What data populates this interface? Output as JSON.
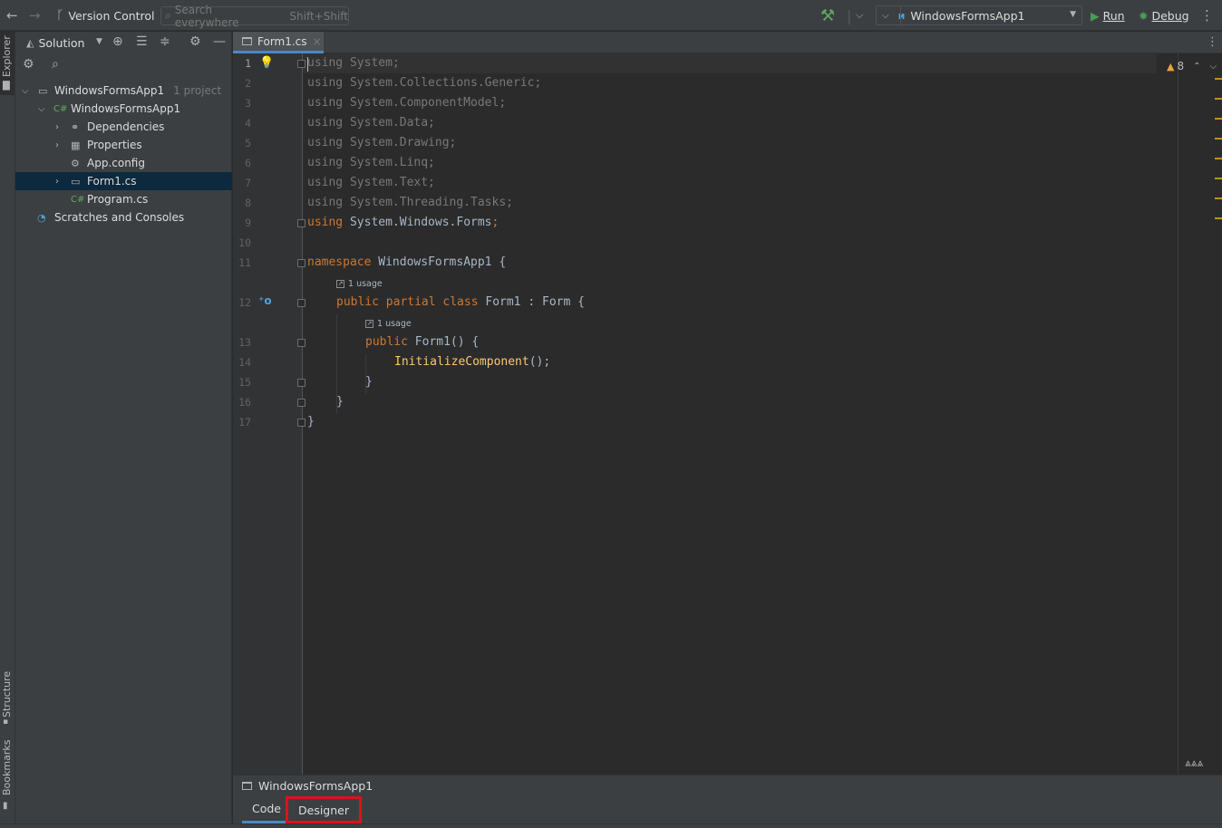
{
  "toolbar": {
    "version_control": "Version Control",
    "search_placeholder": "Search everywhere",
    "search_hint": "Shift+Shift",
    "config": "WindowsFormsApp1",
    "run": "Run",
    "debug": "Debug"
  },
  "strip": {
    "explorer": "Explorer",
    "structure": "Structure",
    "bookmarks": "Bookmarks"
  },
  "explorer": {
    "title": "Solution",
    "tree": [
      {
        "label": "WindowsFormsApp1",
        "sub": "1 project"
      },
      {
        "label": "WindowsFormsApp1"
      },
      {
        "label": "Dependencies"
      },
      {
        "label": "Properties"
      },
      {
        "label": "App.config"
      },
      {
        "label": "Form1.cs"
      },
      {
        "label": "Program.cs"
      },
      {
        "label": "Scratches and Consoles"
      }
    ]
  },
  "editor": {
    "tab": "Form1.cs",
    "warnings": "8",
    "line_numbers": [
      "1",
      "2",
      "3",
      "4",
      "5",
      "6",
      "7",
      "8",
      "9",
      "10",
      "11",
      "12",
      "13",
      "14",
      "15",
      "16",
      "17"
    ],
    "lines": {
      "l1": "using System;",
      "l2": "using System.Collections.Generic;",
      "l3": "using System.ComponentModel;",
      "l4": "using System.Data;",
      "l5": "using System.Drawing;",
      "l6": "using System.Linq;",
      "l7": "using System.Text;",
      "l8": "using System.Threading.Tasks;",
      "l9_kw": "using",
      "l9_rest": " System.Windows.Forms",
      "l9_semi": ";",
      "l11_kw": "namespace",
      "l11_rest": " WindowsFormsApp1 {",
      "l12_kw": "public partial class",
      "l12_rest": " Form1 : Form {",
      "l13_kw": "public",
      "l13_rest": " Form1() {",
      "l14_fn": "InitializeComponent",
      "l14_rest": "();",
      "l15": "}",
      "l16": "}",
      "l17": "}"
    },
    "usage_hint_1": "1 usage",
    "usage_hint_2": "1 usage"
  },
  "bottom": {
    "form_title": "WindowsFormsApp1",
    "tab_code": "Code",
    "tab_designer": "Designer"
  },
  "colors": {
    "keyword": "#cc7832",
    "method": "#ffc66d",
    "highlight_box": "#e0101a"
  }
}
